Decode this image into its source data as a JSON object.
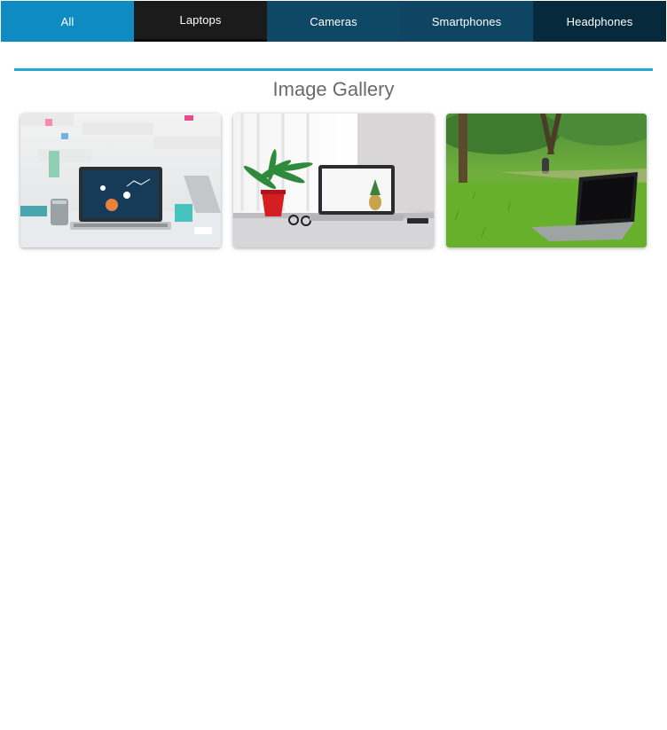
{
  "tabs": [
    {
      "label": "All",
      "active": true,
      "color": "#0e8bc1"
    },
    {
      "label": "Laptops",
      "active": false,
      "color": "#1b1b1b"
    },
    {
      "label": "Cameras",
      "active": false,
      "color": "#0f4766"
    },
    {
      "label": "Smartphones",
      "active": false,
      "color": "#0d4562"
    },
    {
      "label": "Headphones",
      "active": false,
      "color": "#062a3c"
    }
  ],
  "gallery": {
    "title": "Image Gallery",
    "accent_color": "#22a6d6",
    "images": [
      {
        "subject": "laptop-on-office-desk-with-dashboard",
        "icon": "photo-icon"
      },
      {
        "subject": "laptop-on-white-table-with-plant",
        "icon": "photo-icon"
      },
      {
        "subject": "laptop-on-grass-in-park",
        "icon": "photo-icon"
      }
    ]
  }
}
